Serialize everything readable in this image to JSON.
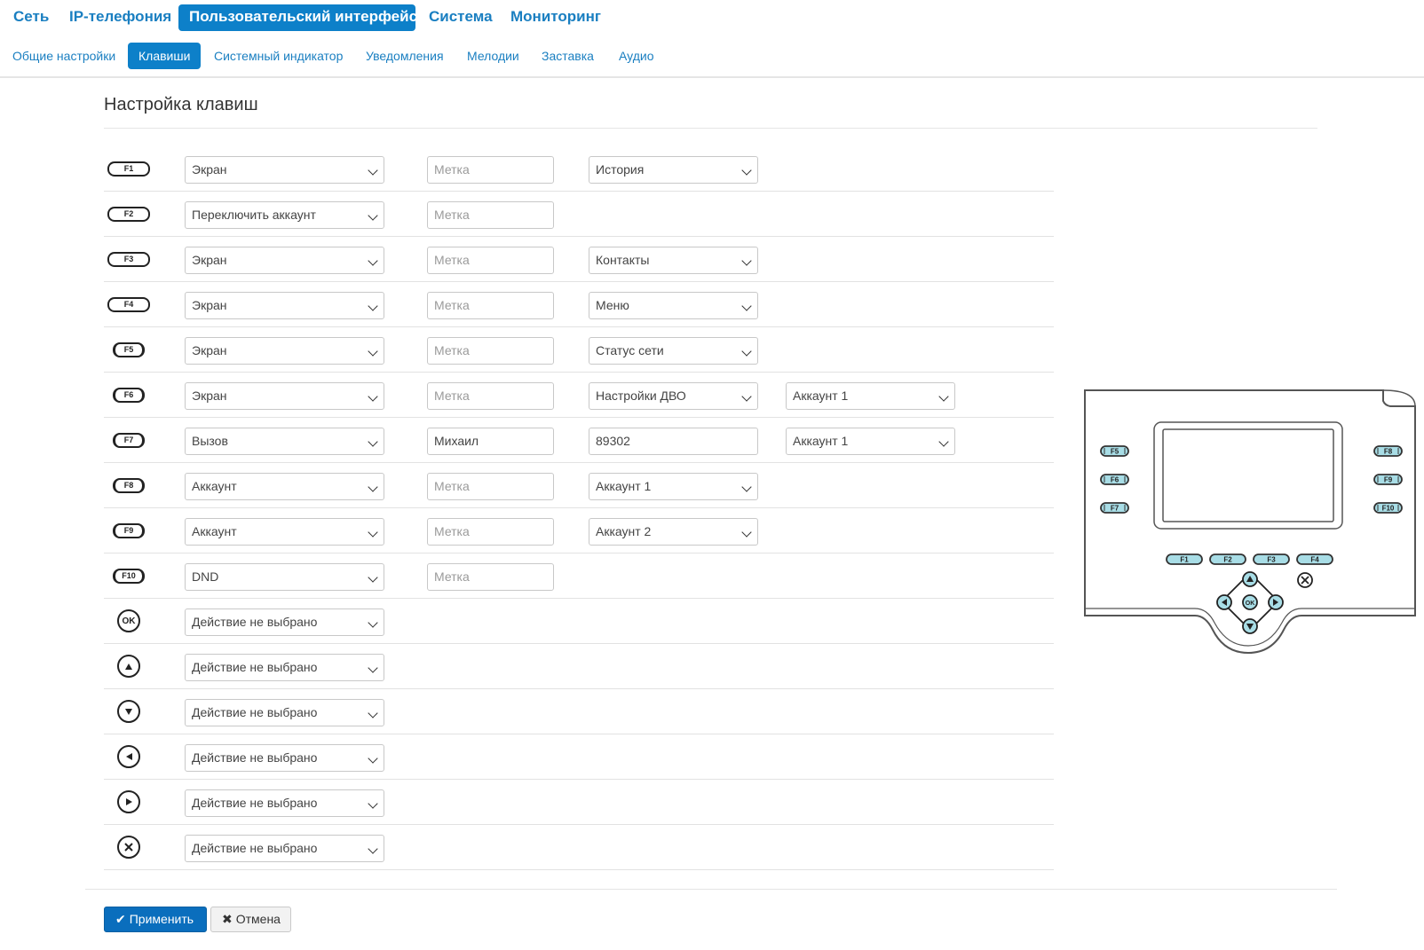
{
  "topnav": [
    {
      "label": "Сеть",
      "active": false
    },
    {
      "label": "IP-телефония",
      "active": false
    },
    {
      "label": "Пользовательский интерфейс",
      "active": true
    },
    {
      "label": "Система",
      "active": false
    },
    {
      "label": "Мониторинг",
      "active": false
    }
  ],
  "subnav": [
    {
      "label": "Общие настройки",
      "active": false
    },
    {
      "label": "Клавиши",
      "active": true
    },
    {
      "label": "Системный индикатор",
      "active": false
    },
    {
      "label": "Уведомления",
      "active": false
    },
    {
      "label": "Мелодии",
      "active": false
    },
    {
      "label": "Заставка",
      "active": false
    },
    {
      "label": "Аудио",
      "active": false
    }
  ],
  "page": {
    "title": "Настройка клавиш"
  },
  "placeholder": "Метка",
  "keys": [
    {
      "key": "F1",
      "kind": "fkey",
      "action": "Экран",
      "label": "",
      "param": "История",
      "param_type": "select",
      "account": ""
    },
    {
      "key": "F2",
      "kind": "fkey",
      "action": "Переключить аккаунт",
      "label": "",
      "param": "",
      "param_type": "",
      "account": ""
    },
    {
      "key": "F3",
      "kind": "fkey",
      "action": "Экран",
      "label": "",
      "param": "Контакты",
      "param_type": "select",
      "account": ""
    },
    {
      "key": "F4",
      "kind": "fkey",
      "action": "Экран",
      "label": "",
      "param": "Меню",
      "param_type": "select",
      "account": ""
    },
    {
      "key": "F5",
      "kind": "side",
      "action": "Экран",
      "label": "",
      "param": "Статус сети",
      "param_type": "select",
      "account": ""
    },
    {
      "key": "F6",
      "kind": "side",
      "action": "Экран",
      "label": "",
      "param": "Настройки ДВО",
      "param_type": "select",
      "account": "Аккаунт 1"
    },
    {
      "key": "F7",
      "kind": "side",
      "action": "Вызов",
      "label": "Михаил",
      "param": "89302",
      "param_type": "input",
      "account": "Аккаунт 1"
    },
    {
      "key": "F8",
      "kind": "side",
      "action": "Аккаунт",
      "label": "",
      "param": "Аккаунт 1",
      "param_type": "select",
      "account": ""
    },
    {
      "key": "F9",
      "kind": "side",
      "action": "Аккаунт",
      "label": "",
      "param": "Аккаунт 2",
      "param_type": "select",
      "account": ""
    },
    {
      "key": "F10",
      "kind": "side",
      "action": "DND",
      "label": "",
      "param": "",
      "param_type": "",
      "account": ""
    },
    {
      "key": "OK",
      "kind": "ok",
      "action": "Действие не выбрано"
    },
    {
      "key": "up-icon",
      "kind": "up",
      "action": "Действие не выбрано"
    },
    {
      "key": "down-icon",
      "kind": "down",
      "action": "Действие не выбрано"
    },
    {
      "key": "left-icon",
      "kind": "left",
      "action": "Действие не выбрано"
    },
    {
      "key": "right-icon",
      "kind": "right",
      "action": "Действие не выбрано"
    },
    {
      "key": "cancel-icon",
      "kind": "cancel",
      "action": "Действие не выбрано"
    }
  ],
  "phone_diagram": {
    "side_left": [
      "F5",
      "F6",
      "F7"
    ],
    "side_right": [
      "F8",
      "F9",
      "F10"
    ],
    "soft": [
      "F1",
      "F2",
      "F3",
      "F4"
    ],
    "ok": "OK"
  },
  "buttons": {
    "apply": "Применить",
    "cancel": "Отмена",
    "apply_icon": "check-icon",
    "cancel_icon": "close-icon"
  },
  "colors": {
    "accent": "#0d80c9",
    "link": "#1a7fc1",
    "apply": "#0a6ebd",
    "diagram_key_fill": "#a8dde6"
  }
}
